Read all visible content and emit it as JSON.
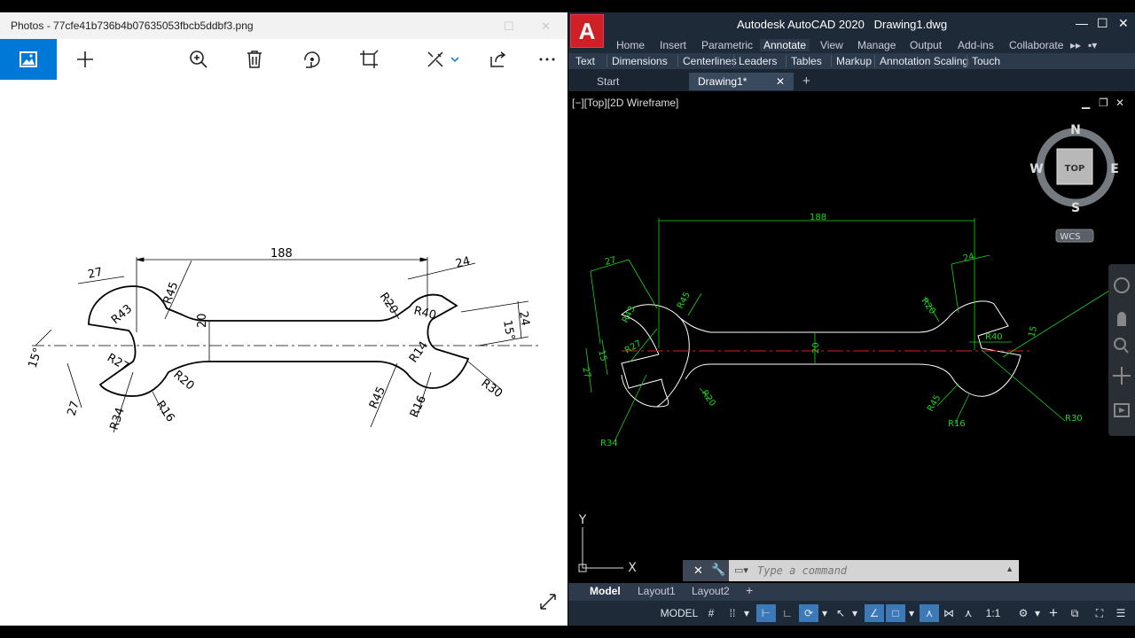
{
  "photos": {
    "title": "Photos - 77cfe41b736b4b07635053fbcb5ddbf3.png",
    "toolbar": [
      "view-icon",
      "add-icon",
      "zoom-icon",
      "delete-icon",
      "rotate-icon",
      "crop-icon",
      "edit-icon",
      "share-icon",
      "more-icon"
    ],
    "drawing": {
      "dims": [
        "188",
        "27",
        "24",
        "20",
        "24",
        "15°",
        "27",
        "15°"
      ],
      "radii": [
        "R45",
        "R43",
        "R27",
        "R20",
        "R34",
        "R16",
        "R20",
        "R40",
        "R14",
        "R30",
        "R45",
        "R16"
      ]
    }
  },
  "acad": {
    "app_title": "Autodesk AutoCAD 2020",
    "file_title": "Drawing1.dwg",
    "logo": "A",
    "ribbon_tabs": [
      "Home",
      "Insert",
      "Parametric",
      "Annotate",
      "View",
      "Manage",
      "Output",
      "Add-ins",
      "Collaborate"
    ],
    "active_tab": "Annotate",
    "panels": [
      "Text",
      "Dimensions",
      "Centerlines",
      "Leaders",
      "Tables",
      "Markup",
      "Annotation Scaling",
      "Touch"
    ],
    "file_tabs": {
      "start": "Start",
      "current": "Drawing1*"
    },
    "viewport_label": "[−][Top][2D Wireframe]",
    "viewcube": {
      "top": "TOP",
      "n": "N",
      "s": "S",
      "e": "E",
      "w": "W",
      "wcs": "WCS"
    },
    "ucs": {
      "x": "X",
      "y": "Y"
    },
    "cad_dims": [
      "188",
      "27",
      "24",
      "20",
      "24",
      "15",
      "27",
      "15"
    ],
    "cad_radii": [
      "R45",
      "R43",
      "R27",
      "R20",
      "R34",
      "R20",
      "R40",
      "R45",
      "R16",
      "R30"
    ],
    "command_placeholder": "Type a command",
    "layout_tabs": [
      "Model",
      "Layout1",
      "Layout2"
    ],
    "status": {
      "model": "MODEL",
      "scale": "1:1"
    },
    "colors": {
      "dim": "#1bd41b",
      "centerline": "#d42020",
      "geometry": "#ffffff",
      "accent": "#3b79b8"
    }
  }
}
